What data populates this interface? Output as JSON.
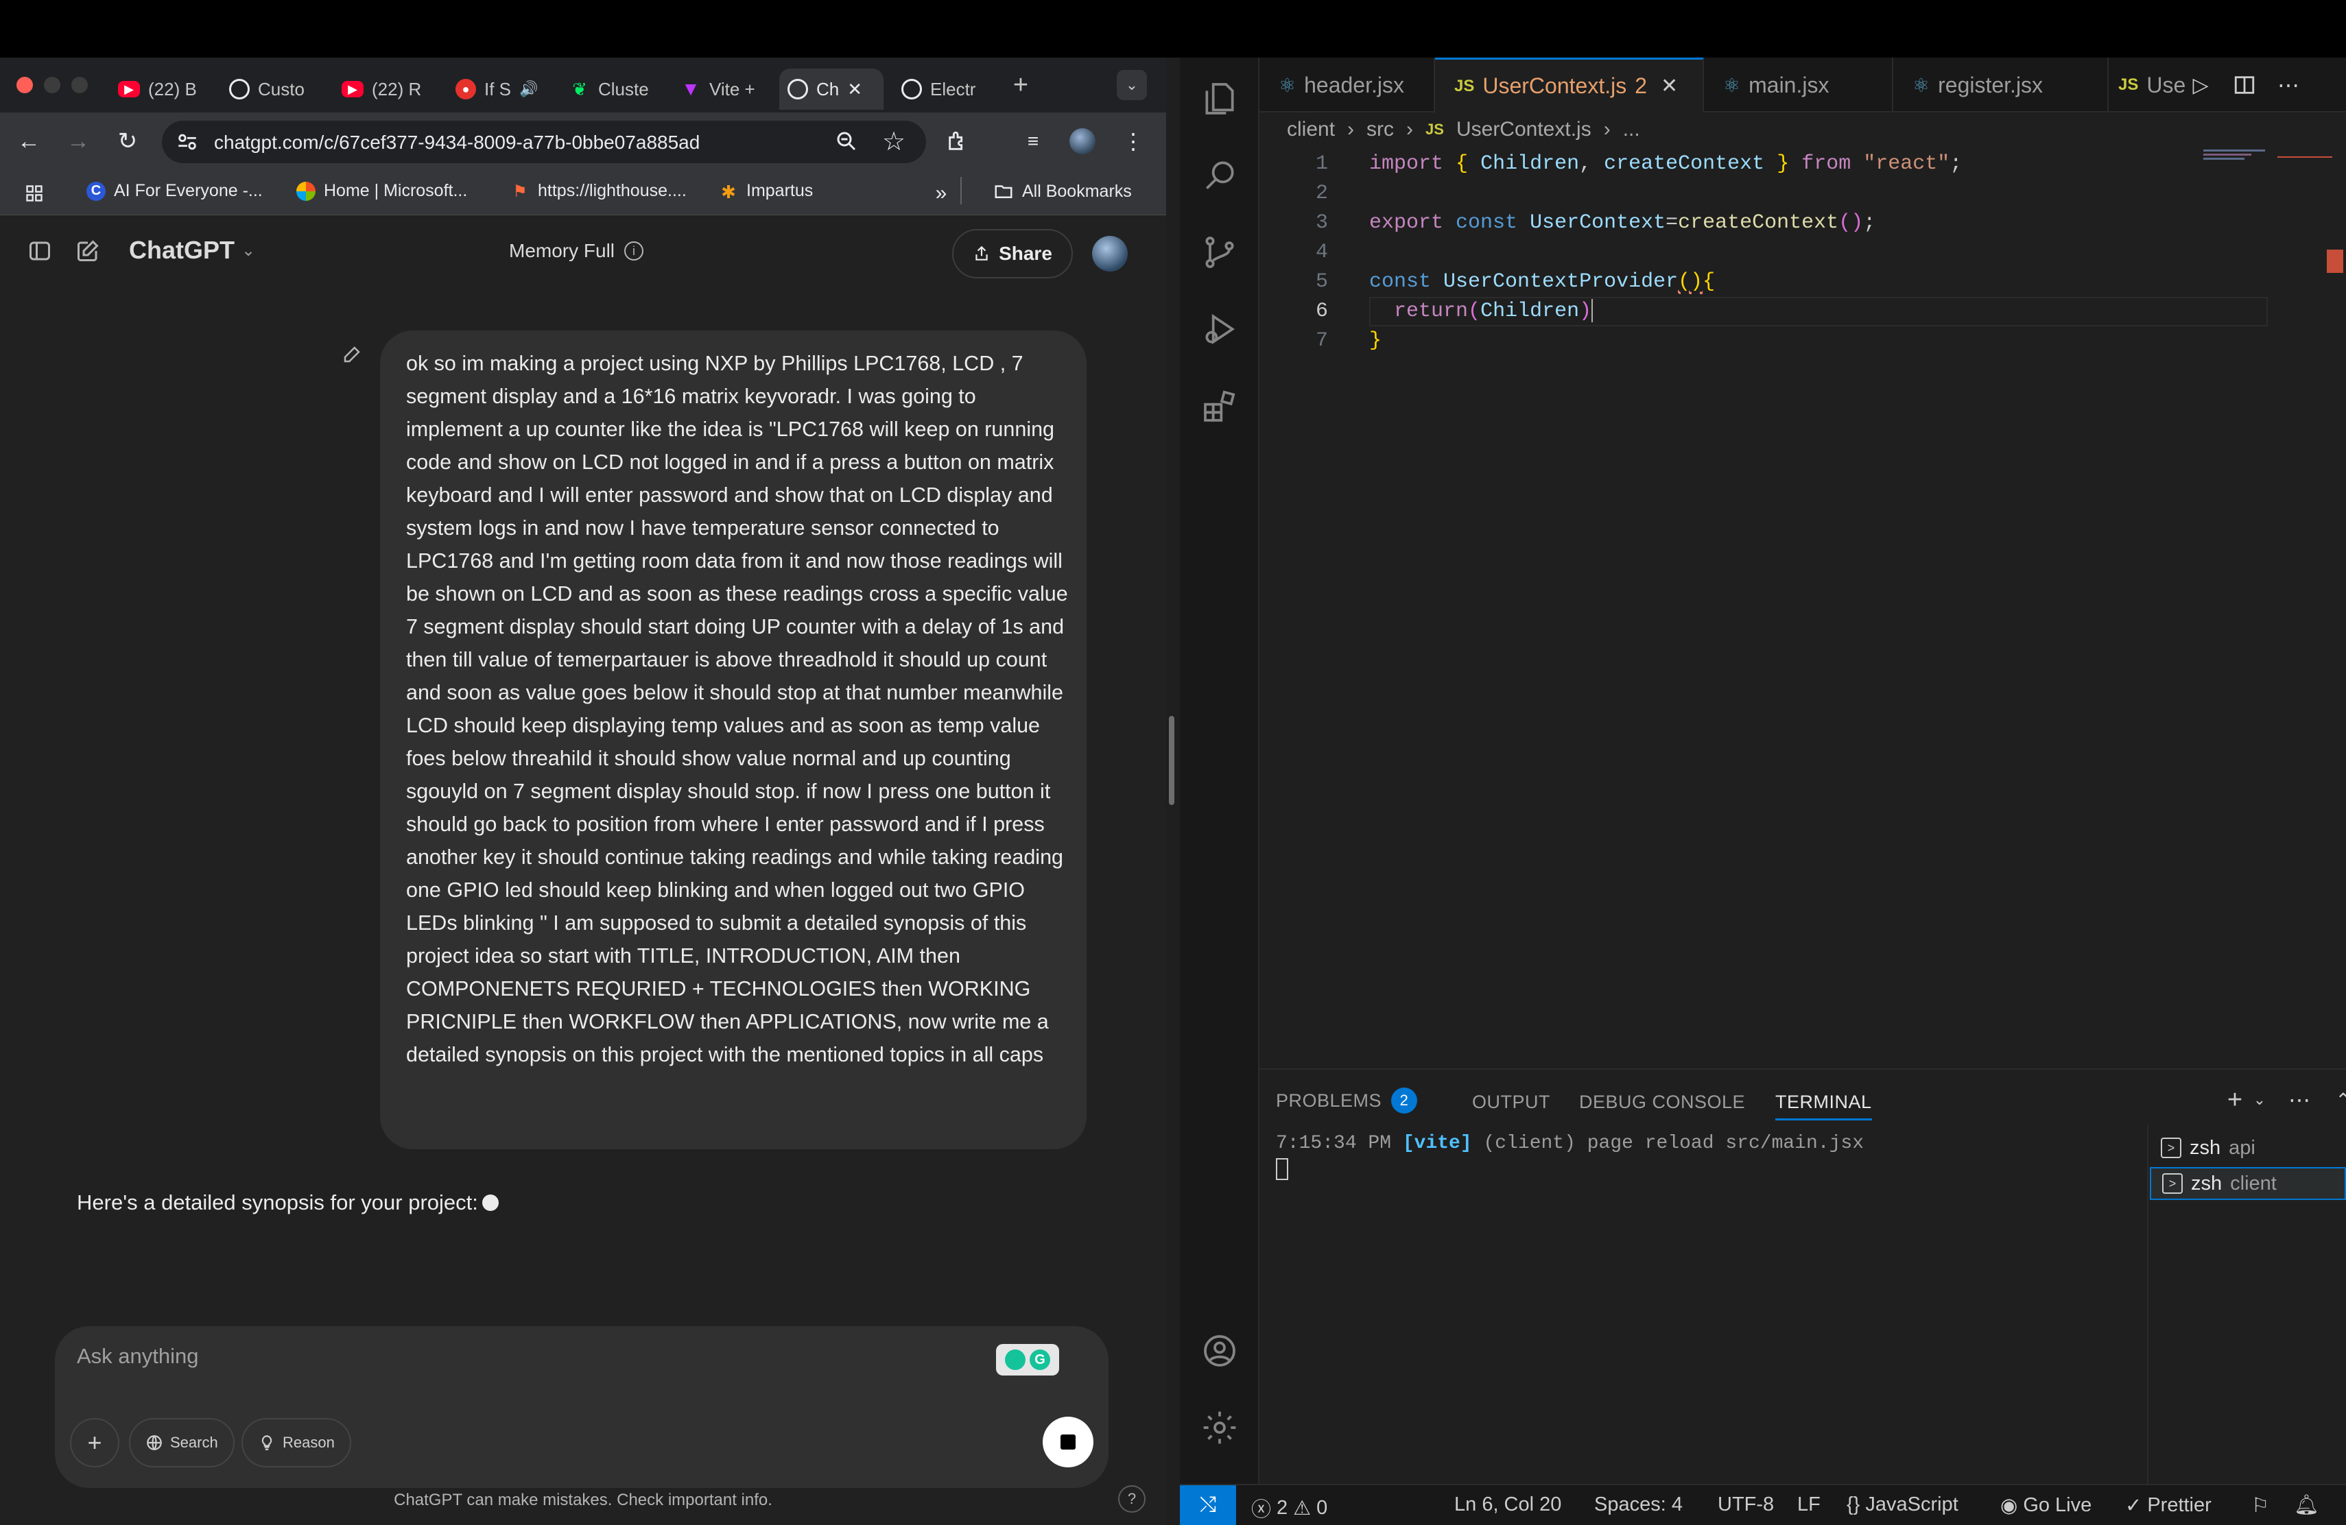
{
  "browser": {
    "tabs": [
      {
        "label": "(22) B",
        "icon": "youtube-icon"
      },
      {
        "label": "Custo",
        "icon": "openai-icon"
      },
      {
        "label": "(22) R",
        "icon": "youtube-icon"
      },
      {
        "label": "If S",
        "icon": "podcast-icon"
      },
      {
        "label": "Cluste",
        "icon": "mongodb-icon"
      },
      {
        "label": "Vite +",
        "icon": "vite-icon"
      },
      {
        "label": "Ch",
        "icon": "openai-icon",
        "active": true
      },
      {
        "label": "Electr",
        "icon": "openai-icon"
      }
    ],
    "url": "chatgpt.com/c/67cef377-9434-8009-a77b-0bbe07a885ad",
    "bookmarks": [
      {
        "label": "AI For Everyone -..."
      },
      {
        "label": "Home | Microsoft..."
      },
      {
        "label": "https://lighthouse...."
      },
      {
        "label": "Impartus"
      }
    ],
    "all_bookmarks_label": "All Bookmarks"
  },
  "chatgpt": {
    "title": "ChatGPT",
    "memory_label": "Memory Full",
    "share_label": "Share",
    "user_message": "ok so im making a project using NXP by Phillips LPC1768, LCD , 7 segment display and a 16*16 matrix keyvoradr. I was going to implement a up counter like the idea is \"LPC1768 will keep on running code and show on LCD not logged in and if a press a button on matrix keyboard and I will enter password and show that on LCD display and system logs in and now I have temperature sensor connected to LPC1768 and I'm getting room data from it and now those readings will be shown on LCD and as soon as these readings cross a specific value 7 segment display should start doing UP counter with a delay of 1s and then till value of temerpartauer is above threadhold it should up count and soon as value goes below it should stop at that number meanwhile LCD should keep displaying temp values and as soon as temp value foes below threahild it should show value normal and up counting sgouyld on 7 segment display should stop. if now I press one button it should go back to position from where I enter password and if I press another key it should continue taking readings and while taking reading one GPIO led should keep blinking and when logged out two GPIO LEDs blinking \" I am supposed to submit a detailed synopsis of this project idea so start with TITLE, INTRODUCTION, AIM then COMPONENETS REQURIED + TECHNOLOGIES then  WORKING PRICNIPLE then WORKFLOW then APPLICATIONS, now write me a detailed synopsis on this project with the mentioned topics in all caps",
    "assistant_message": "Here's a detailed synopsis for your project:",
    "composer_placeholder": "Ask anything",
    "search_label": "Search",
    "reason_label": "Reason",
    "disclaimer": "ChatGPT can make mistakes. Check important info.",
    "help_label": "?"
  },
  "vscode": {
    "tabs": [
      {
        "label": "header.jsx",
        "icon": "react-icon"
      },
      {
        "label": "UserContext.js",
        "badge": "2",
        "icon": "js-icon",
        "active": true
      },
      {
        "label": "main.jsx",
        "icon": "react-icon"
      },
      {
        "label": "register.jsx",
        "icon": "react-icon"
      },
      {
        "label": "Use",
        "icon": "js-icon"
      }
    ],
    "breadcrumb": [
      "client",
      "src",
      "UserContext.js",
      "..."
    ],
    "code_lines": [
      {
        "n": "1"
      },
      {
        "n": "2"
      },
      {
        "n": "3"
      },
      {
        "n": "4"
      },
      {
        "n": "5"
      },
      {
        "n": "6"
      },
      {
        "n": "7"
      }
    ],
    "panel": {
      "tabs": [
        "PROBLEMS",
        "OUTPUT",
        "DEBUG CONSOLE",
        "TERMINAL"
      ],
      "problems_count": "2",
      "terminal_line": {
        "time": "7:15:34 PM",
        "tag": "[vite]",
        "rest": "(client) page reload",
        "file": "src/main.jsx"
      },
      "terminals": [
        {
          "shell": "zsh",
          "name": "api"
        },
        {
          "shell": "zsh",
          "name": "client"
        }
      ]
    },
    "status": {
      "errors": "2",
      "warnings": "0",
      "position": "Ln 6, Col 20",
      "spaces": "Spaces: 4",
      "encoding": "UTF-8",
      "eol": "LF",
      "language": "JavaScript",
      "golive": "Go Live",
      "prettier": "Prettier"
    }
  }
}
